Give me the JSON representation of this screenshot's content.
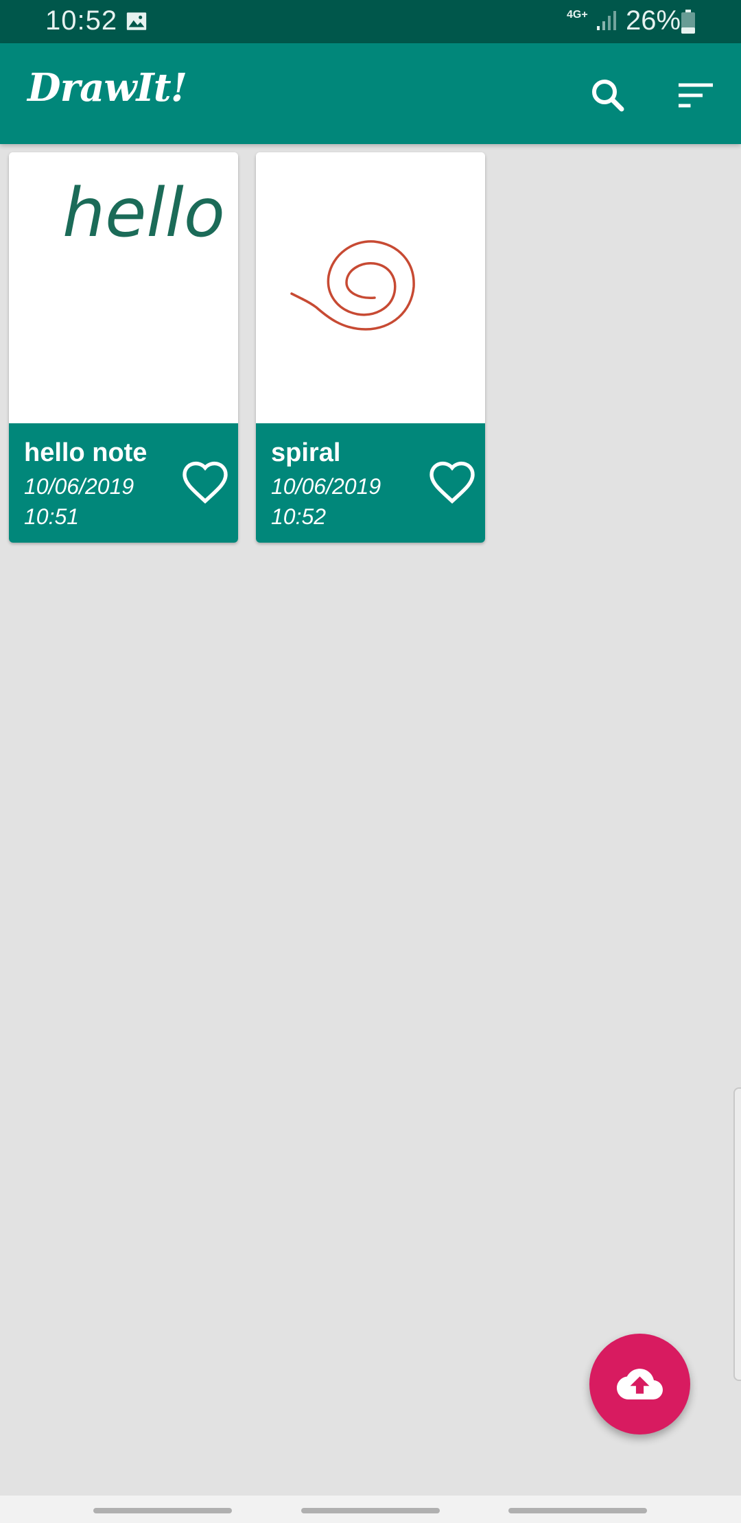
{
  "status_bar": {
    "time": "10:52",
    "network": "4G+",
    "battery_percent": "26%",
    "icons": [
      "image-icon",
      "signal-icon",
      "battery-icon"
    ]
  },
  "app_bar": {
    "title": "DrawIt!",
    "actions": [
      "search-icon",
      "sort-icon"
    ]
  },
  "notes": [
    {
      "name": "hello note",
      "date": "10/06/2019",
      "time": "10:51",
      "thumbnail_text": "hello",
      "thumbnail_color": "#1b6b58",
      "favorite_icon": "heart-outline-icon"
    },
    {
      "name": "spiral",
      "date": "10/06/2019",
      "time": "10:52",
      "thumbnail_color": "#c74a33",
      "favorite_icon": "heart-outline-icon"
    }
  ],
  "fab": {
    "icon": "cloud-upload-icon"
  },
  "colors": {
    "status_bar": "#00574b",
    "primary": "#01877a",
    "accent": "#d81b60",
    "background": "#e2e2e2"
  }
}
